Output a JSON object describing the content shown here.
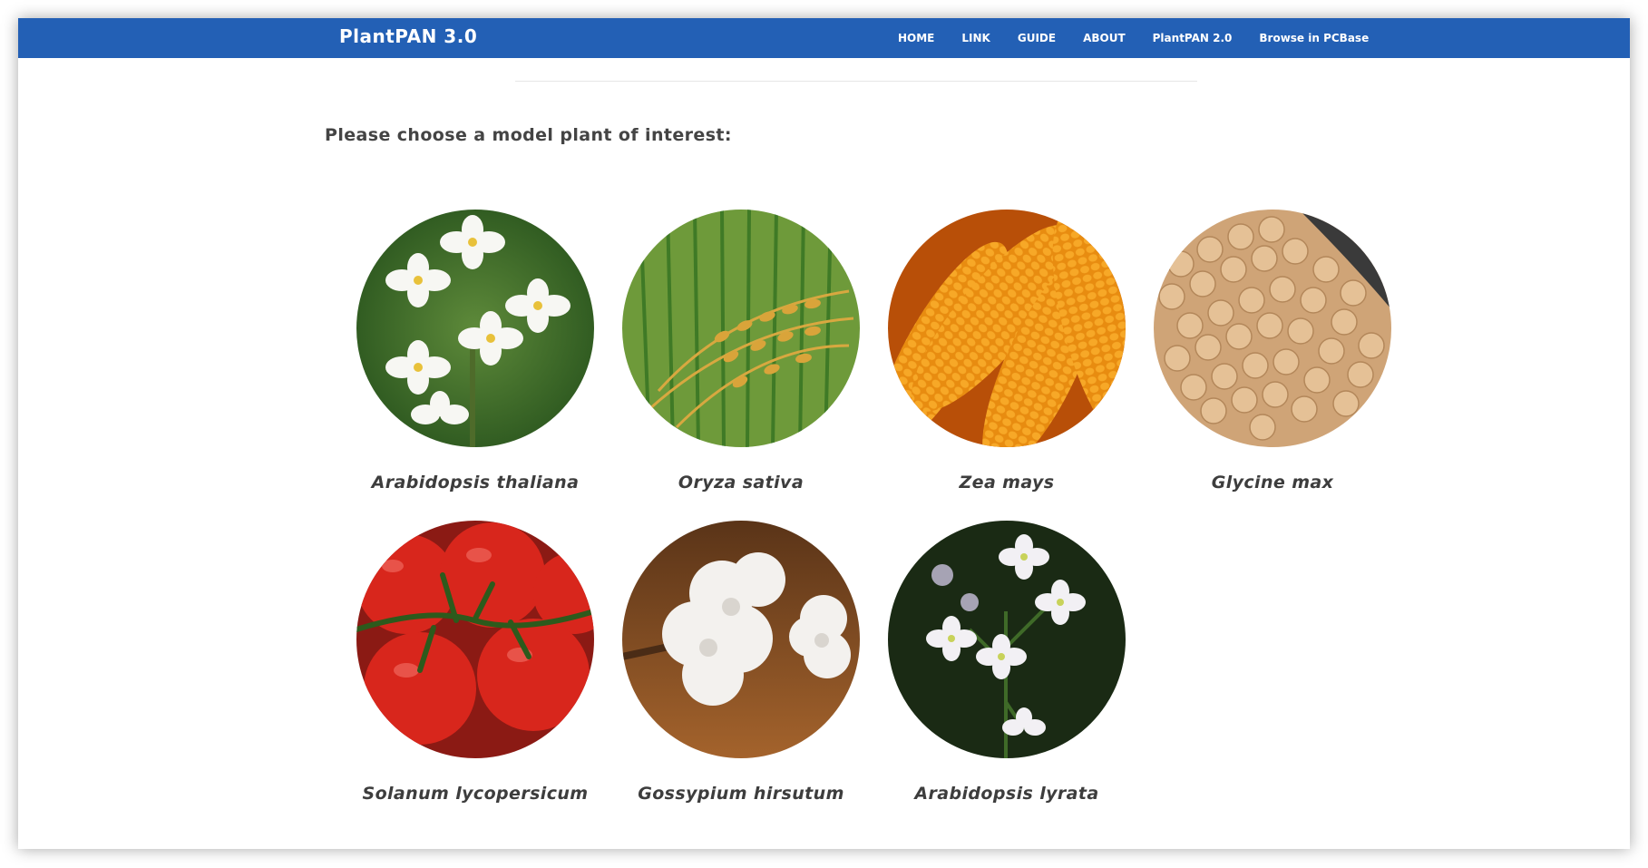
{
  "app": {
    "title": "PlantPAN 3.0"
  },
  "nav": {
    "items": [
      {
        "label": "HOME"
      },
      {
        "label": "LINK"
      },
      {
        "label": "GUIDE"
      },
      {
        "label": "ABOUT"
      },
      {
        "label": "PlantPAN 2.0"
      },
      {
        "label": "Browse in PCBase"
      }
    ]
  },
  "main": {
    "prompt": "Please choose a model plant of interest:",
    "plants": [
      {
        "name": "Arabidopsis thaliana",
        "image": "white-flowers"
      },
      {
        "name": "Oryza sativa",
        "image": "rice-grains"
      },
      {
        "name": "Zea mays",
        "image": "corn-cobs"
      },
      {
        "name": "Glycine max",
        "image": "soybeans"
      },
      {
        "name": "Solanum lycopersicum",
        "image": "tomatoes"
      },
      {
        "name": "Gossypium hirsutum",
        "image": "cotton-bolls"
      },
      {
        "name": "Arabidopsis lyrata",
        "image": "white-flowers-dark"
      }
    ]
  },
  "colors": {
    "navbar": "#2360b5",
    "text": "#444444"
  }
}
